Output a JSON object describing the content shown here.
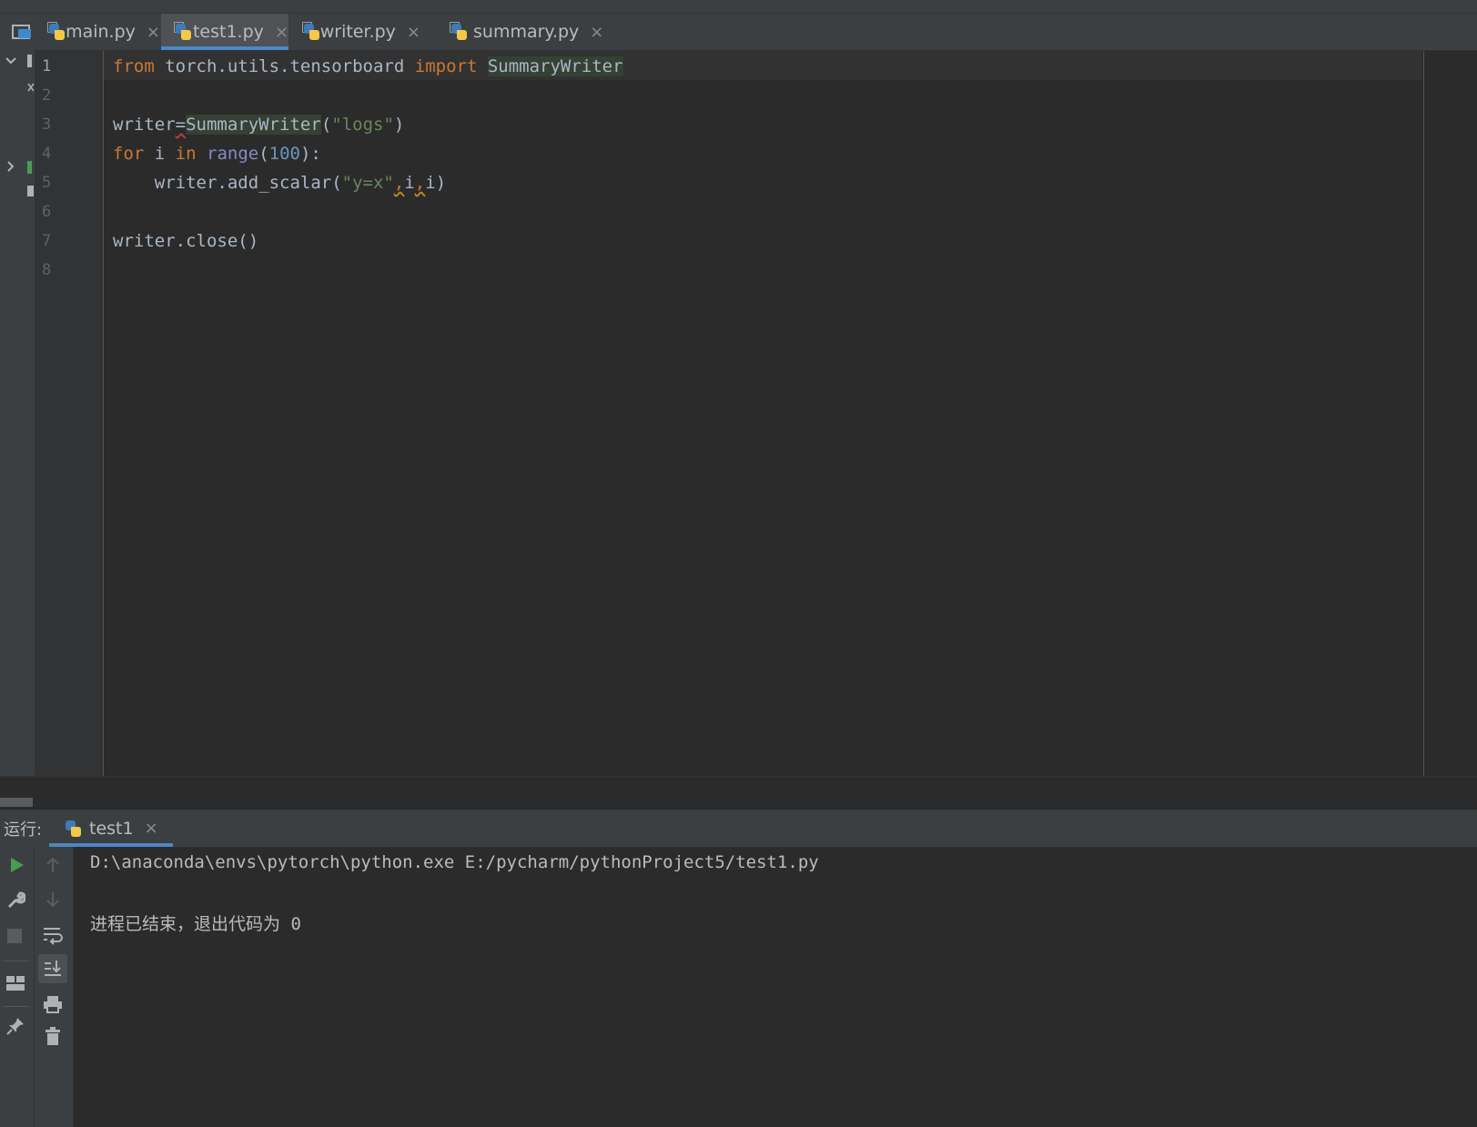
{
  "editor": {
    "tabs": [
      {
        "label": "main.py",
        "active": false
      },
      {
        "label": "test1.py",
        "active": true
      },
      {
        "label": "writer.py",
        "active": false
      },
      {
        "label": "summary.py",
        "active": false
      }
    ],
    "close_glyph": "×",
    "line_numbers": [
      "1",
      "2",
      "3",
      "4",
      "5",
      "6",
      "7",
      "8"
    ],
    "code": {
      "l1_from": "from",
      "l1_module": " torch.utils.tensorboard ",
      "l1_import": "import",
      "l1_space": " ",
      "l1_class": "SummaryWriter",
      "l3_var": "writer",
      "l3_eq": "=",
      "l3_class": "SummaryWriter",
      "l3_open": "(",
      "l3_str": "\"logs\"",
      "l3_close": ")",
      "l4_for": "for",
      "l4_i": " i ",
      "l4_in": "in",
      "l4_space": " ",
      "l4_range": "range",
      "l4_open": "(",
      "l4_num": "100",
      "l4_close": "):",
      "l5_call": "    writer.add_scalar(",
      "l5_str": "\"y=x\"",
      "l5_c1": ",",
      "l5_i1": "i",
      "l5_c2": ",",
      "l5_i2": "i",
      "l5_end": ")",
      "l7": "writer.close()"
    }
  },
  "run_panel": {
    "title": "运行:",
    "tab_label": "test1",
    "output": [
      "D:\\anaconda\\envs\\pytorch\\python.exe E:/pycharm/pythonProject5/test1.py",
      "",
      "进程已结束，退出代码为 0"
    ]
  },
  "icons": {
    "left_strip": [
      "project-view-icon",
      "collapse-chevron-icon",
      "expand-chevron-icon"
    ],
    "run_left": [
      "run-icon",
      "wrench-icon",
      "stop-icon",
      "layout-icon",
      "pin-icon"
    ],
    "run_left2": [
      "arrow-up-icon",
      "arrow-down-icon",
      "soft-wrap-icon",
      "scroll-to-end-icon",
      "print-icon",
      "trash-icon"
    ]
  },
  "colors": {
    "keyword": "#cc7832",
    "builtin": "#8888c6",
    "number": "#6897bb",
    "string": "#6a8759",
    "accent": "#4a88c7",
    "run_green": "#499c54"
  }
}
